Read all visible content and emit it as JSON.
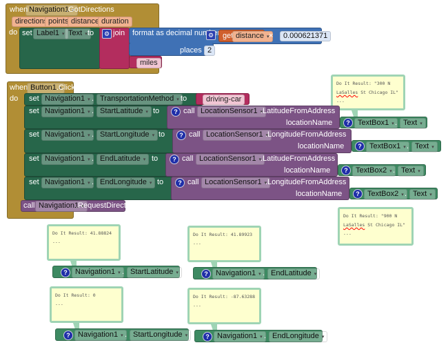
{
  "colors": {
    "event": "#b18e35",
    "setter": "#27664a",
    "getter": "#3d8a62",
    "method": "#7c5385",
    "math": "#3f71b5",
    "text": "#b32d5e",
    "variable": "#d05f2d",
    "comment": "#feffcf"
  },
  "got_directions": {
    "when": "when",
    "component": "Navigation1",
    "event": ".GotDirections",
    "params": [
      "directions",
      "points",
      "distance",
      "duration"
    ],
    "do": "do",
    "set": "set",
    "target": "Label1",
    "prop": "Text",
    "to": "to",
    "join": "join",
    "format": "format as decimal number",
    "get": "get",
    "var": "distance",
    "times": "×",
    "factor": "0.000621371",
    "places": "places",
    "places_val": "2",
    "miles": "miles"
  },
  "click": {
    "when": "when",
    "component": "Button1",
    "event": ".Click",
    "do": "do",
    "set": "set",
    "dot": ".",
    "to": "to",
    "call": "call",
    "location_name": "locationName",
    "rows": [
      {
        "comp": "Navigation1",
        "prop": "TransportationMethod",
        "value": "driving-car"
      },
      {
        "comp": "Navigation1",
        "prop": "StartLatitude",
        "sensor": "LocationSensor1",
        "method": ".LatitudeFromAddress",
        "box": "TextBox1",
        "boxprop": "Text"
      },
      {
        "comp": "Navigation1",
        "prop": "StartLongitude",
        "sensor": "LocationSensor1",
        "method": ".LongitudeFromAddress",
        "box": "TextBox1",
        "boxprop": "Text"
      },
      {
        "comp": "Navigation1",
        "prop": "EndLatitude",
        "sensor": "LocationSensor1",
        "method": ".LatitudeFromAddress",
        "box": "TextBox2",
        "boxprop": "Text"
      },
      {
        "comp": "Navigation1",
        "prop": "EndLongitude",
        "sensor": "LocationSensor1",
        "method": ".LongitudeFromAddress",
        "box": "TextBox2",
        "boxprop": "Text"
      }
    ],
    "request_comp": "Navigation1",
    "request": ".RequestDirections"
  },
  "comments": {
    "c1": {
      "l1": "Do It Result: \"300 N",
      "l2a": "LaSalles",
      "l2b": " St Chicago IL\"",
      "l3": "---"
    },
    "c2": {
      "l1": "Do It Result: \"900 N",
      "l2a": "LaSalles",
      "l2b": " St Chicago IL\"",
      "l3": "---"
    }
  },
  "probes": [
    {
      "result": "Do It Result: 41.88824",
      "dash": "---",
      "comp": "Navigation1",
      "prop": "StartLatitude"
    },
    {
      "result": "Do It Result: 41.89923",
      "dash": "---",
      "comp": "Navigation1",
      "prop": "EndLatitude"
    },
    {
      "result": "Do It Result: 0",
      "dash": "---",
      "comp": "Navigation1",
      "prop": "StartLongitude"
    },
    {
      "result": "Do It Result: -87.63288",
      "dash": "---",
      "comp": "Navigation1",
      "prop": "EndLongitude"
    }
  ]
}
